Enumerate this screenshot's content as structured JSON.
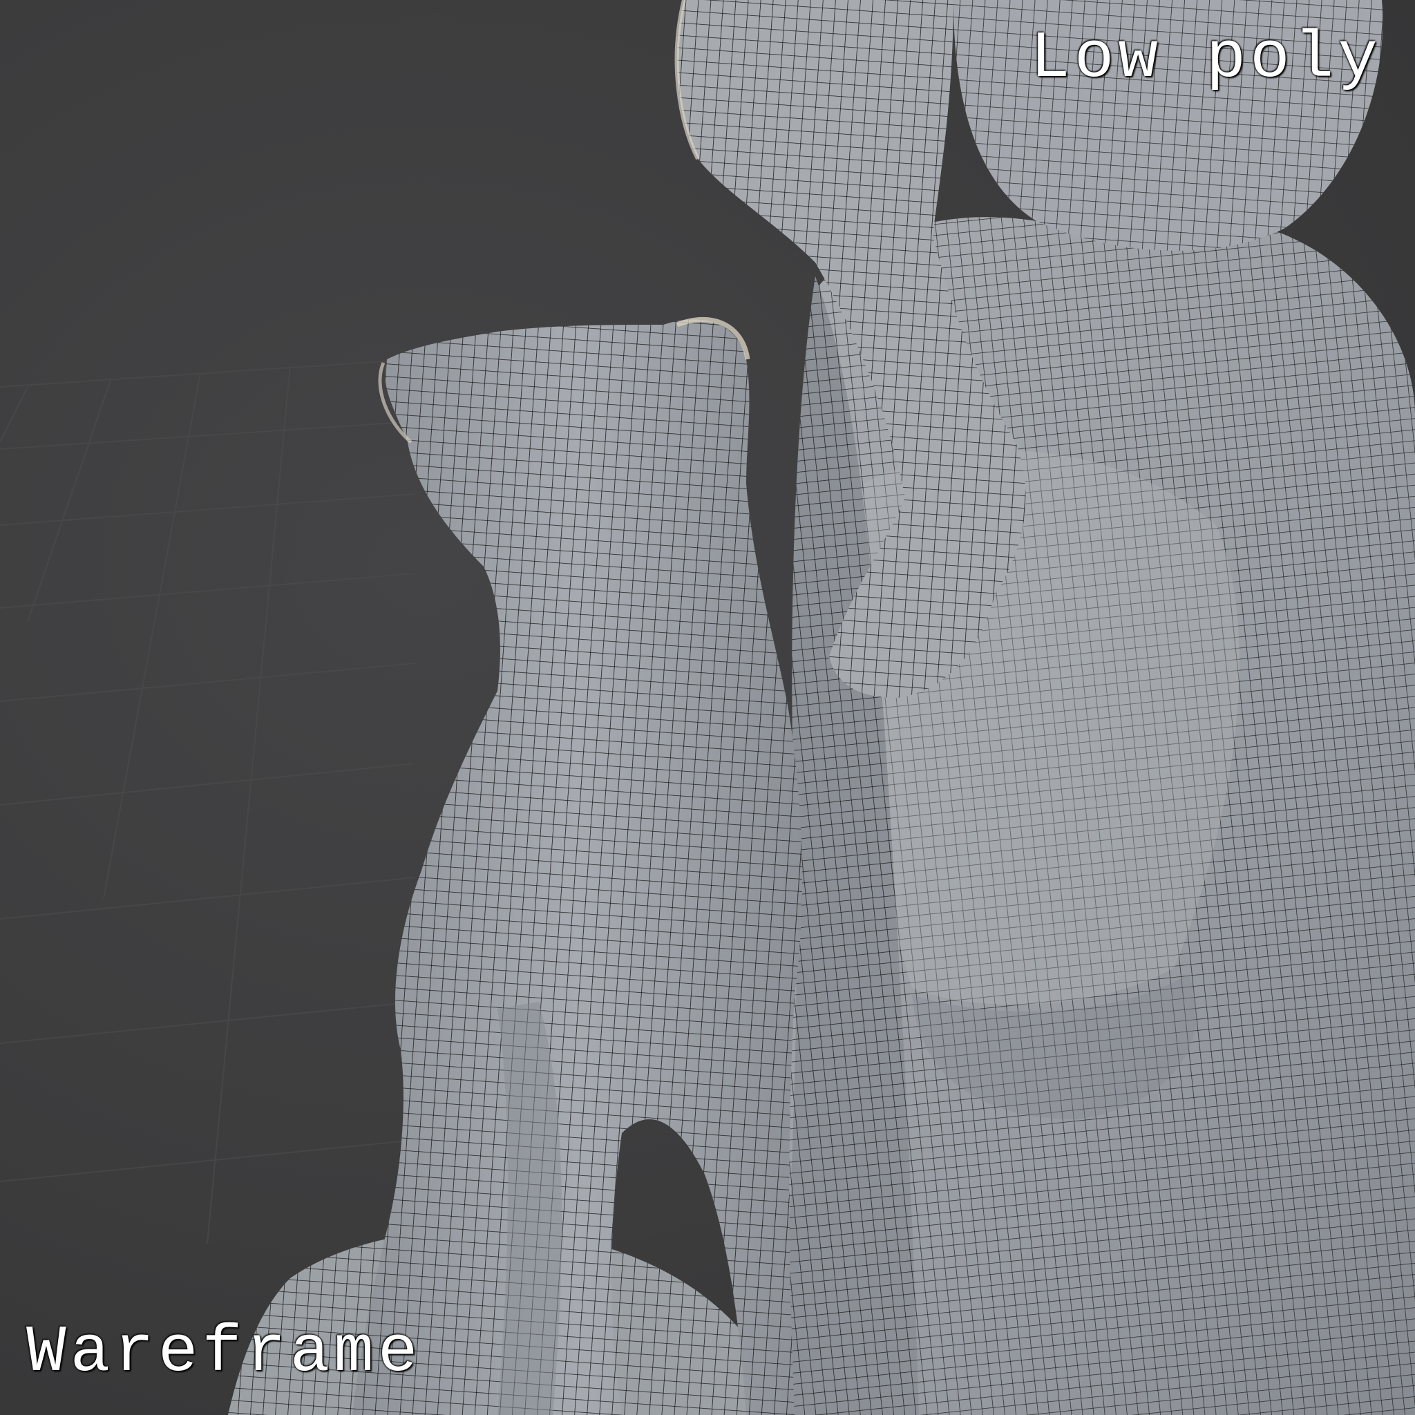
{
  "labels": {
    "top_right": "Low poly",
    "bottom_left": "Wareframe"
  },
  "colors": {
    "background": "#3b3b3b",
    "grid": "#4a4a4a",
    "mesh_surface": "#9da2a8",
    "mesh_highlight": "#c9c6bc",
    "wire": "#1e1e1e",
    "text": "#ffffff"
  },
  "scene": {
    "subject": "sculpture-wireframe-render",
    "icons": [
      "floor-grid",
      "dog-figure",
      "human-figure",
      "arm-figure",
      "base-rock"
    ]
  }
}
